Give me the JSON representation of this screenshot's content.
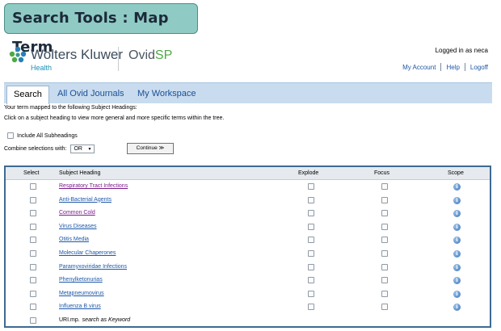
{
  "banner": {
    "title": "Search Tools : Map Term"
  },
  "brand": {
    "name": "Wolters Kluwer",
    "sub": "Health",
    "product_main": "Ovid",
    "product_accent": "SP"
  },
  "account": {
    "logged_in": "Logged in as neca",
    "links": [
      "My Account",
      "Help",
      "Logoff"
    ]
  },
  "tabs": [
    {
      "label": "Search",
      "active": true
    },
    {
      "label": "All Ovid Journals",
      "active": false
    },
    {
      "label": "My Workspace",
      "active": false
    }
  ],
  "info": {
    "line1": "Your term mapped to the following Subject Headings:",
    "line2": "Click on a subject heading to view more general and more specific terms within the tree."
  },
  "options": {
    "include_subheadings": "Include All Subheadings",
    "combine_label": "Combine selections with:",
    "combine_value": "OR",
    "continue_label": "Continue ≫"
  },
  "table": {
    "headers": {
      "select": "Select",
      "subject": "Subject Heading",
      "explode": "Explode",
      "focus": "Focus",
      "scope": "Scope"
    },
    "rows": [
      {
        "heading": "Respiratory Tract Infections",
        "visited": true
      },
      {
        "heading": "Anti-Bacterial Agents",
        "visited": false
      },
      {
        "heading": "Common Cold",
        "visited": true
      },
      {
        "heading": "Virus Diseases",
        "visited": false
      },
      {
        "heading": "Otitis Media",
        "visited": false
      },
      {
        "heading": "Molecular Chaperones",
        "visited": false
      },
      {
        "heading": "Paramyxoviridae Infections",
        "visited": false
      },
      {
        "heading": "Phenylketonurias",
        "visited": false
      },
      {
        "heading": "Metapneumovirus",
        "visited": false
      },
      {
        "heading": "Influenza B virus",
        "visited": false
      }
    ],
    "keyword_row": {
      "term": "URI.mp.",
      "suffix": "search as Keyword"
    }
  },
  "colors": {
    "accent": "#1e58a8",
    "tabbar": "#c9dcef",
    "banner": "#8fcbc4",
    "table_border": "#3d6a93"
  },
  "icons": {
    "scope": "info-icon",
    "logo": "wolters-kluwer-logo-icon"
  }
}
